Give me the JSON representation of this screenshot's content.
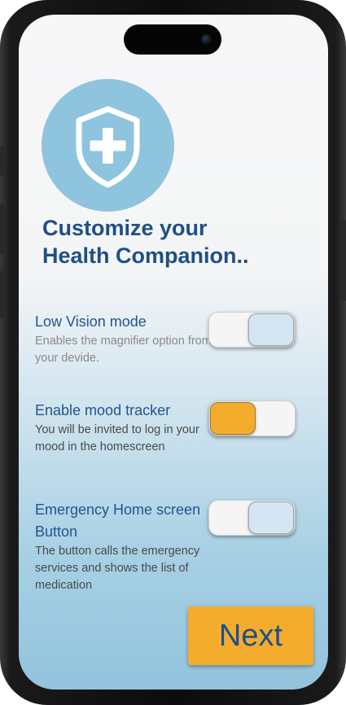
{
  "colors": {
    "title": "#1f4f86",
    "accent": "#f4ac2d",
    "logo_bg": "#8fc4de",
    "knob_off": "#d4e6f2",
    "knob_on": "#f4ac2d"
  },
  "header": {
    "logo_icon": "shield-plus-icon",
    "title_line1": "Customize your",
    "title_line2": "Health Companion.."
  },
  "settings": [
    {
      "label": "Low Vision mode",
      "description": "Enables the magnifier option from your devide.",
      "enabled": false
    },
    {
      "label": "Enable mood tracker",
      "description": "You will be invited to log in your mood in the homescreen",
      "enabled": true
    },
    {
      "label": "Emergency Home screen Button",
      "description": "The button calls the emergency services and shows the list of medication",
      "enabled": false
    }
  ],
  "footer": {
    "next_label": "Next"
  }
}
